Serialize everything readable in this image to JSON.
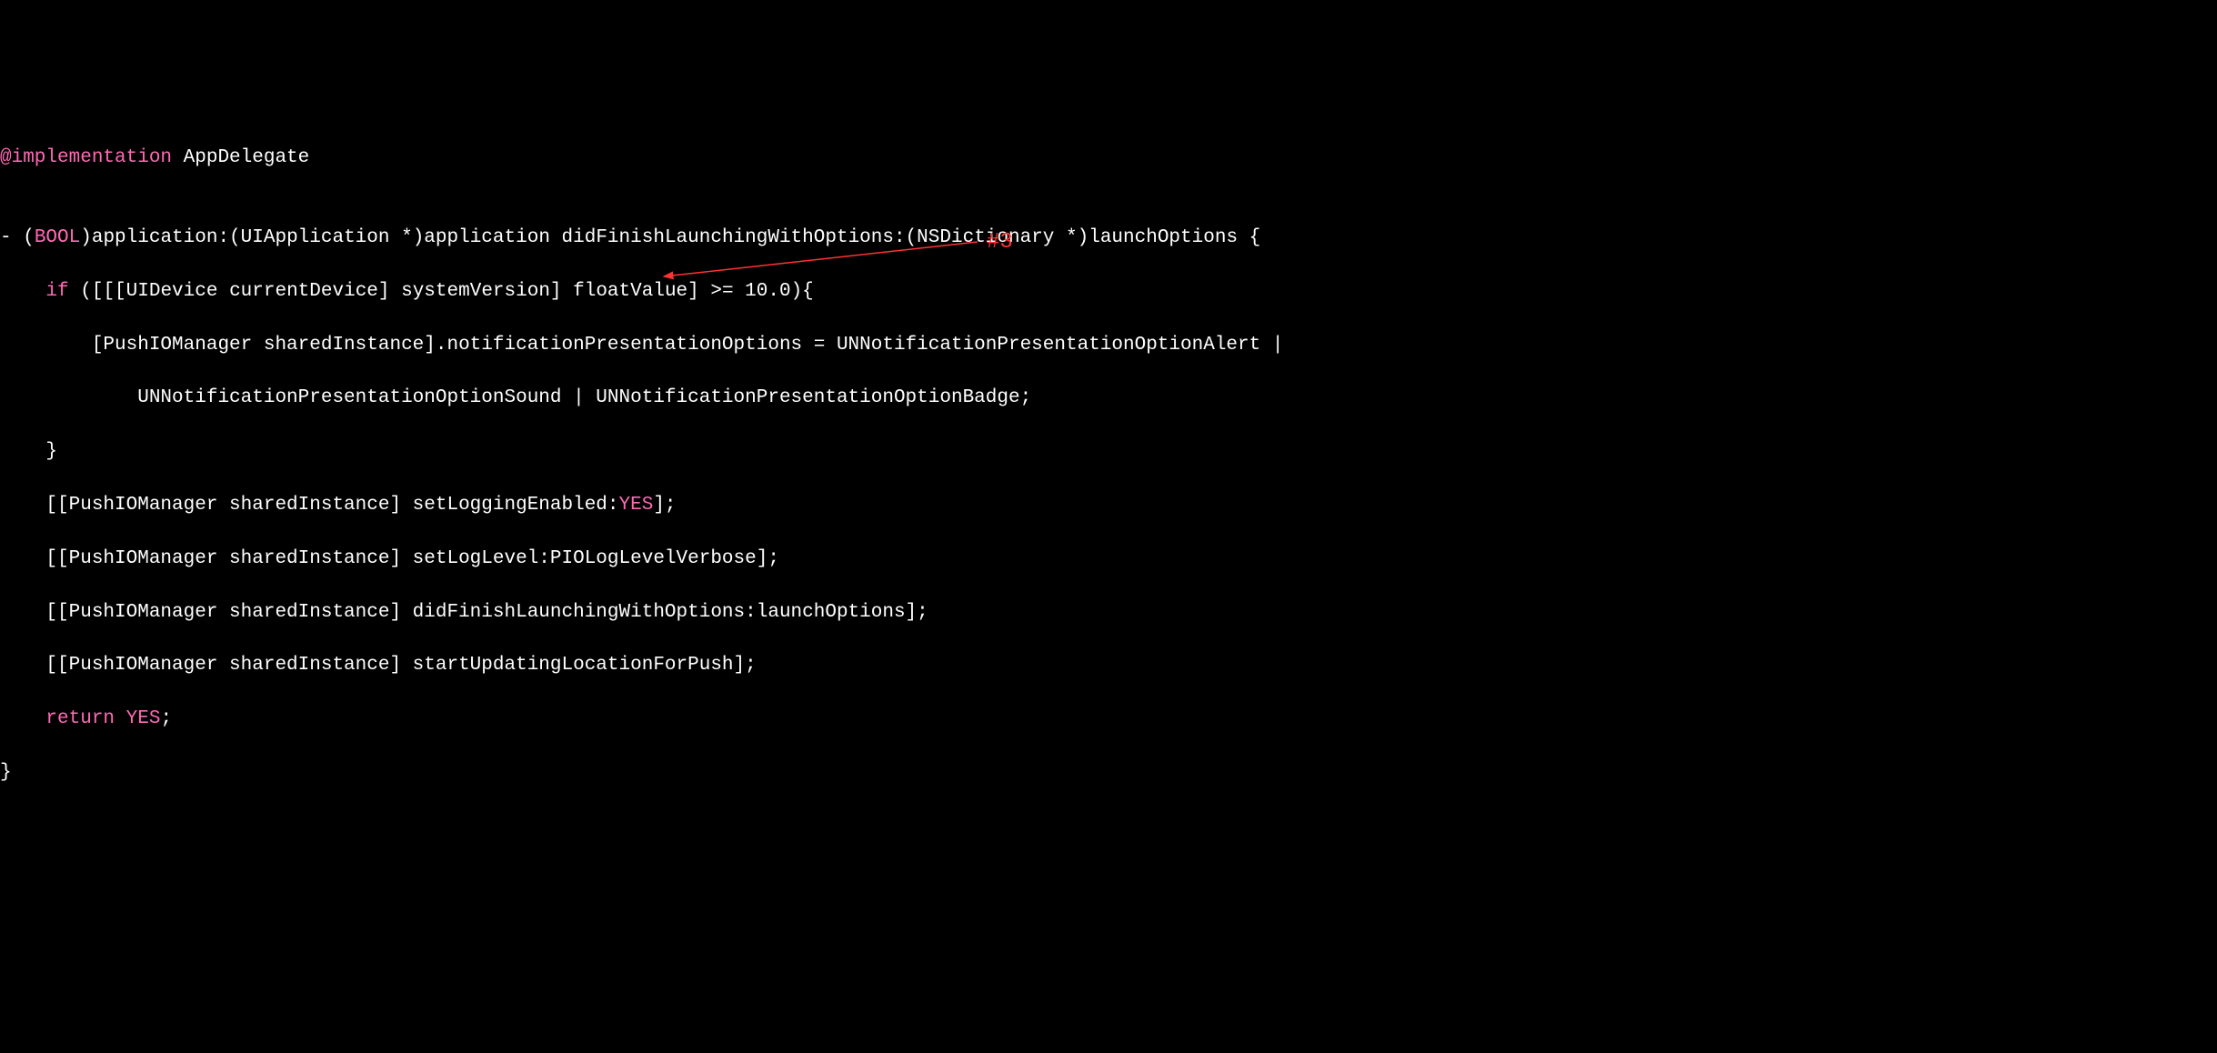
{
  "code": {
    "line1": {
      "prefix": "@implementation",
      "suffix": " AppDelegate"
    },
    "line2": "",
    "line3": {
      "p1": "- (",
      "p2": "BOOL",
      "p3": ")application:(UIApplication *)application didFinishLaunchingWithOptions:(NSDictionary *)launchOptions {"
    },
    "line4": {
      "p1": "    ",
      "p2": "if",
      "p3": " ([[[UIDevice currentDevice] systemVersion] floatValue] >= 10.0){"
    },
    "line5": "        [PushIOManager sharedInstance].notificationPresentationOptions = UNNotificationPresentationOptionAlert |",
    "line6": "            UNNotificationPresentationOptionSound | UNNotificationPresentationOptionBadge;",
    "line7": "    }",
    "line8": {
      "p1": "    [[PushIOManager sharedInstance] setLoggingEnabled:",
      "p2": "YES",
      "p3": "];"
    },
    "line9": "    [[PushIOManager sharedInstance] setLogLevel:PIOLogLevelVerbose];",
    "line10": "    [[PushIOManager sharedInstance] didFinishLaunchingWithOptions:launchOptions];",
    "line11": "    [[PushIOManager sharedInstance] startUpdatingLocationForPush];",
    "line12": {
      "p1": "    ",
      "p2": "return",
      "p3": " ",
      "p4": "YES",
      "p5": ";"
    },
    "line13": "}"
  },
  "annotation": {
    "label": "#3",
    "target_line": 11
  }
}
